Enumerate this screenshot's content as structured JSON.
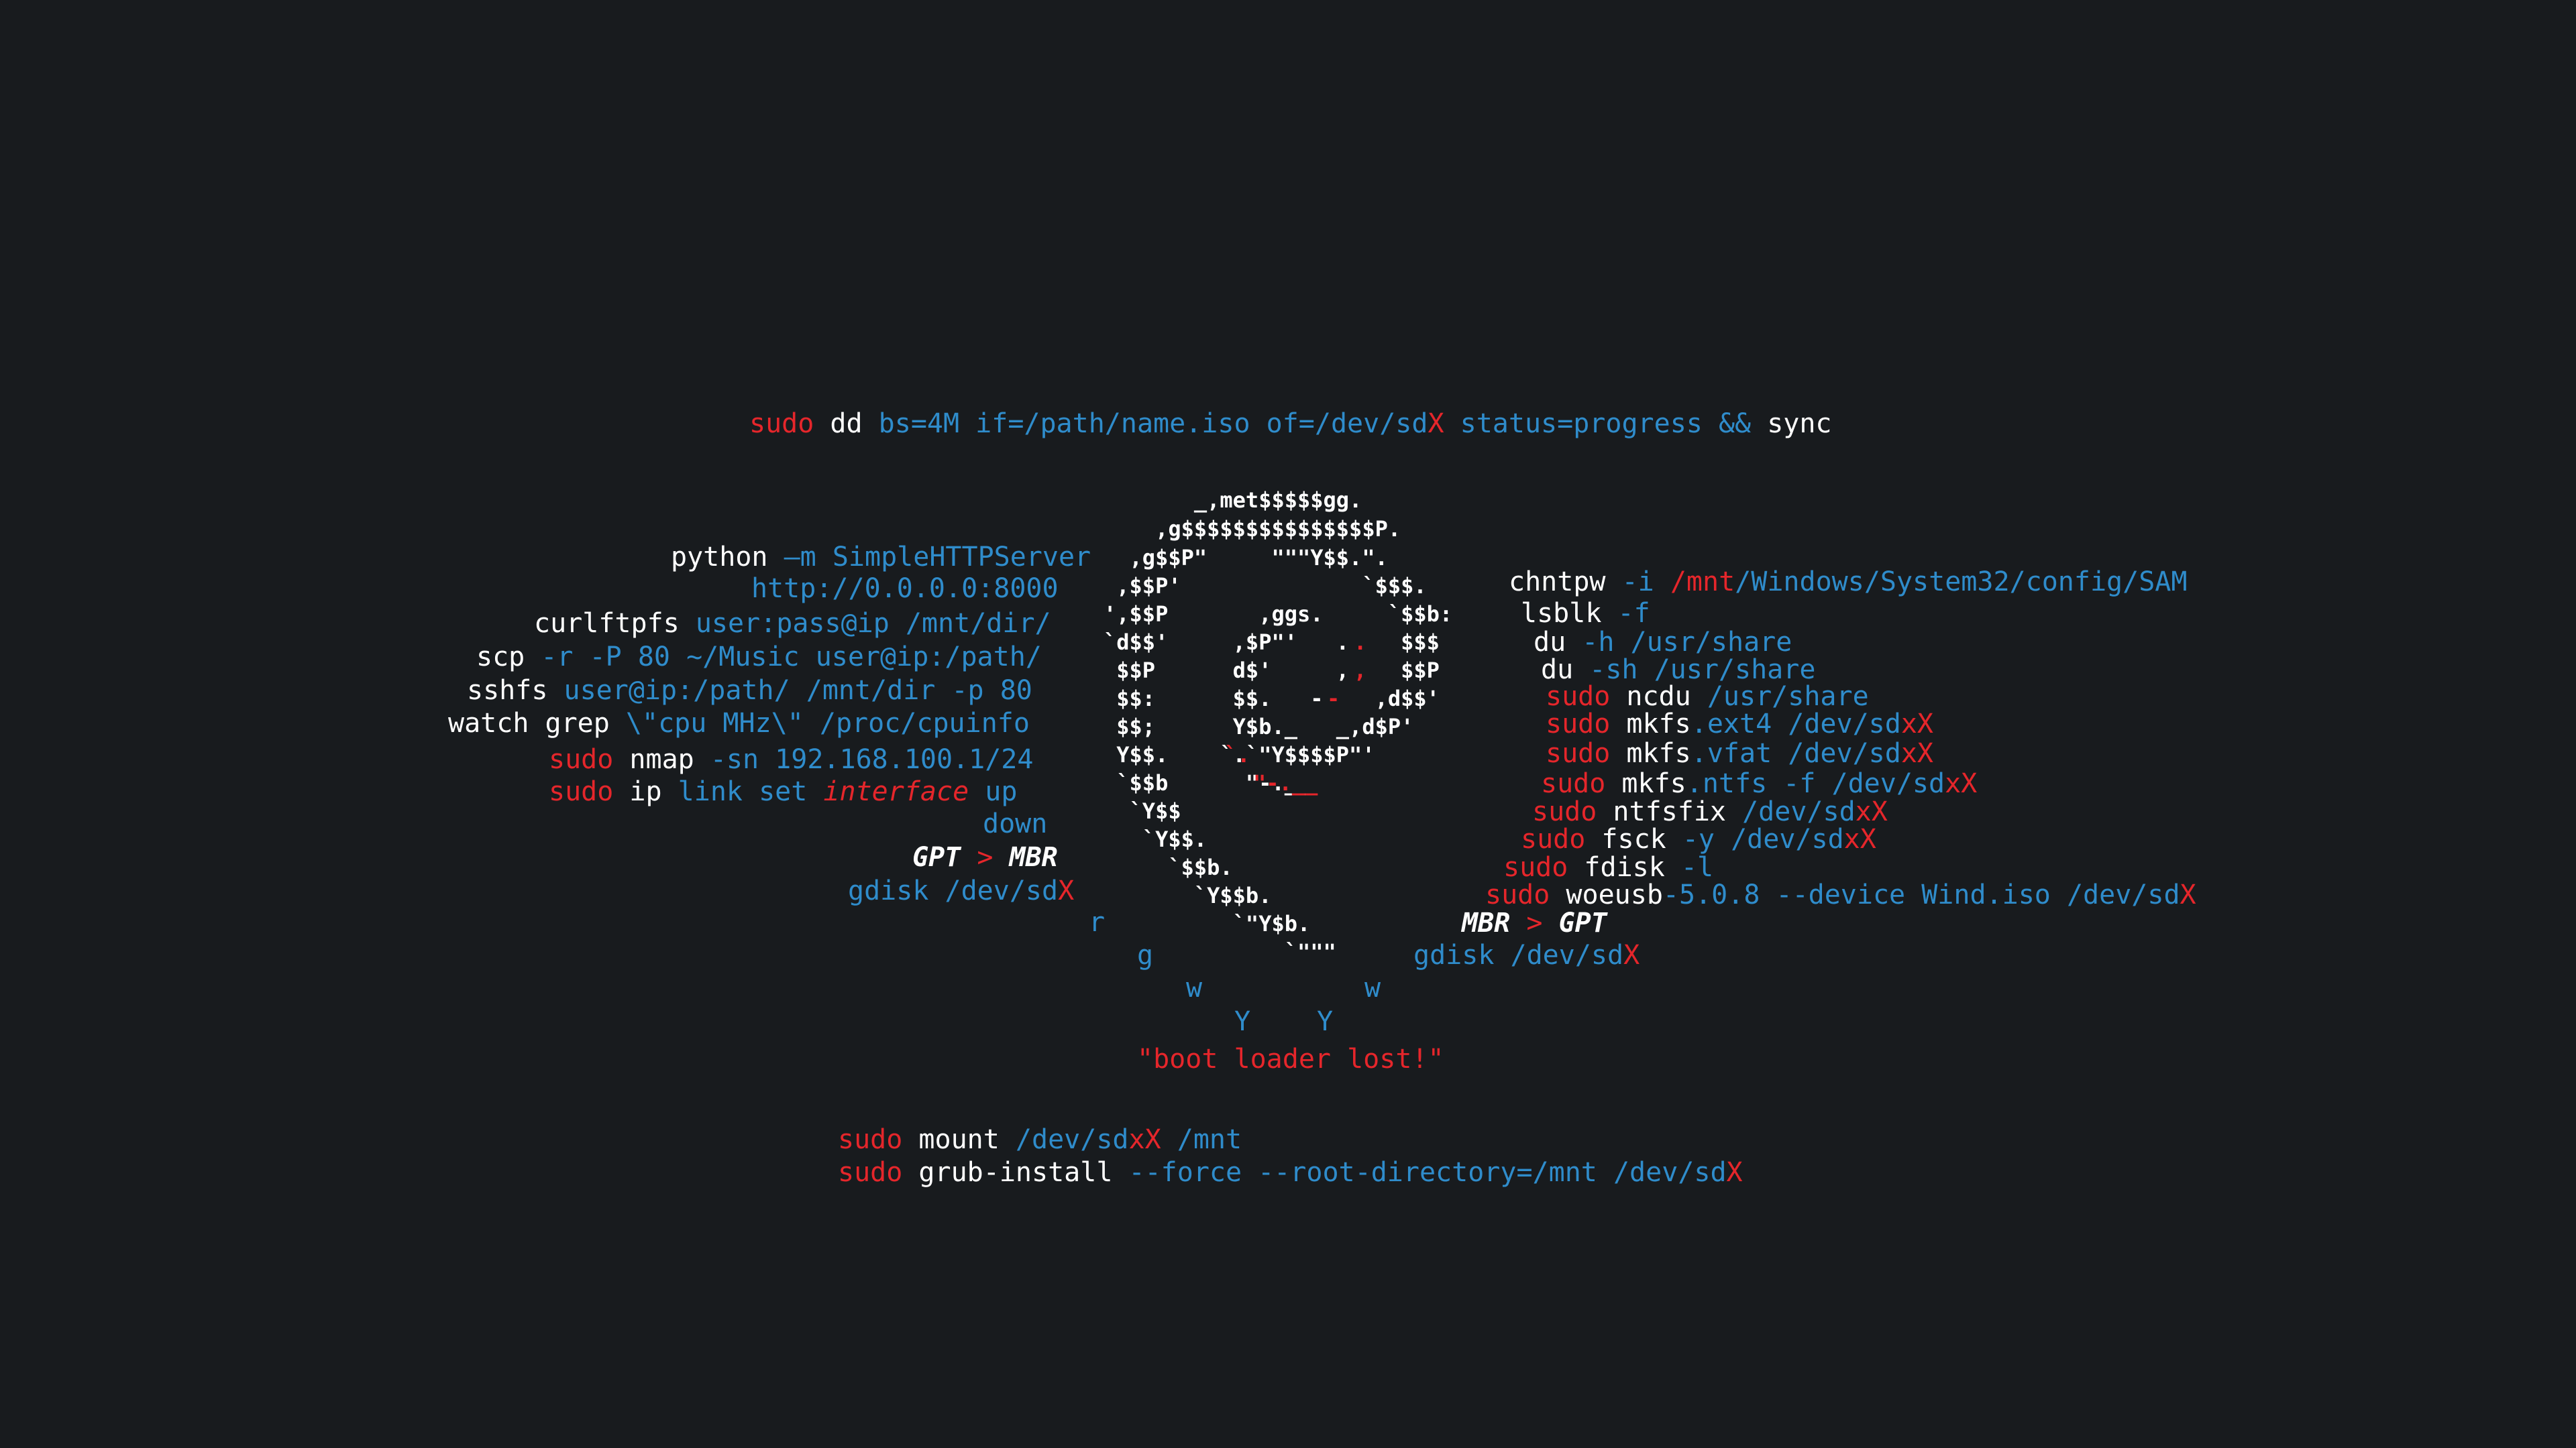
{
  "colors": {
    "background": "#181b1e",
    "white": "#ffffff",
    "red": "#e5262b",
    "blue": "#2f8ccb"
  },
  "dd": [
    "sudo",
    " dd ",
    "bs=4M if=/path/name.iso of=/dev/sd",
    "X",
    " status=progress && ",
    "sync"
  ],
  "left": {
    "python": [
      "python ",
      "—m SimpleHTTPServer"
    ],
    "http": "http://0.0.0.0:8000",
    "curlftpfs": [
      "curlftpfs ",
      "user:pass@ip /mnt/dir/"
    ],
    "scp": [
      "scp ",
      "-r -P 80 ~/Music user@ip:/path/"
    ],
    "sshfs": [
      "sshfs ",
      "user@ip:/path/ /mnt/dir -p 80"
    ],
    "watch": [
      "watch grep ",
      "\\\"cpu MHz\\\" /proc/cpuinfo"
    ],
    "nmap": [
      "sudo",
      " nmap ",
      "-sn 192.168.100.1/24"
    ],
    "ip": [
      "sudo",
      " ip ",
      "link set ",
      "interface",
      " up"
    ],
    "down": "down",
    "gpt_mbr": [
      "GPT",
      " > ",
      "MBR"
    ],
    "gdisk": [
      "gdisk /dev/sd",
      "X"
    ]
  },
  "right": {
    "chntpw": [
      "chntpw ",
      "-i ",
      "/mnt",
      "/Windows/System32/config/SAM"
    ],
    "lsblk": [
      "lsblk ",
      "-f"
    ],
    "du_h": [
      "du ",
      "-h /usr/share"
    ],
    "du_sh": [
      "du ",
      "-sh /usr/share"
    ],
    "ncdu": [
      "sudo",
      " ncdu ",
      "/usr/share"
    ],
    "mkfs_ext4": [
      "sudo",
      " mkfs",
      ".ext4 /dev/sd",
      "xX"
    ],
    "mkfs_vfat": [
      "sudo",
      " mkfs",
      ".vfat /dev/sd",
      "xX"
    ],
    "mkfs_ntfs": [
      "sudo",
      " mkfs",
      ".ntfs -f /dev/sd",
      "xX"
    ],
    "ntfsfix": [
      "sudo",
      " ntfsfix ",
      "/dev/sd",
      "xX"
    ],
    "fsck": [
      "sudo",
      " fsck ",
      "-y /dev/sd",
      "xX"
    ],
    "fdisk": [
      "sudo",
      " fdisk ",
      "-l"
    ],
    "woeusb": [
      "sudo",
      " woeusb",
      "-5.0.8 --device Wind.iso /dev/sd",
      "X"
    ],
    "mbr_gpt": [
      "MBR",
      " > ",
      "GPT"
    ],
    "gdisk": [
      "gdisk /dev/sd",
      "X"
    ]
  },
  "art": [
    "       _,met$$$$$gg.",
    "    ,g$$$$$$$$$$$$$$$P.",
    "  ,g$$P\"     \"\"\"Y$$.\".",
    " ,$$P'              `$$$.",
    "',$$P       ,ggs.     `$$b:",
    "`d$$'     ,$P\"'   .    $$$",
    " $$P      d$'     ,    $$P",
    " $$:      $$.   -    ,d$$'",
    " $$;      Y$b._   _,d$P'",
    " Y$$.    `.`\"Y$$$$P\"'",
    " `$$b      \"-.__",
    "  `Y$$",
    "   `Y$$.",
    "     `$$b.",
    "       `Y$$b.",
    "          `\"Y$b.",
    "              `\"\"\""
  ],
  "art_red": {
    "dot": ".",
    "comma": ",",
    "dash": "-",
    "tick": "`.",
    "tail": "\"-.__"
  },
  "rgwy": {
    "r": "r",
    "g": "g",
    "w1": "w",
    "w2": "w",
    "y1": "Y",
    "y2": "Y"
  },
  "boot_lost": "\"boot loader lost!\"",
  "mount": [
    "sudo",
    " mount ",
    "/dev/sd",
    "xX",
    " /mnt"
  ],
  "grub": [
    "sudo",
    " grub-install ",
    "--force --root-directory=/mnt /dev/sd",
    "X"
  ]
}
